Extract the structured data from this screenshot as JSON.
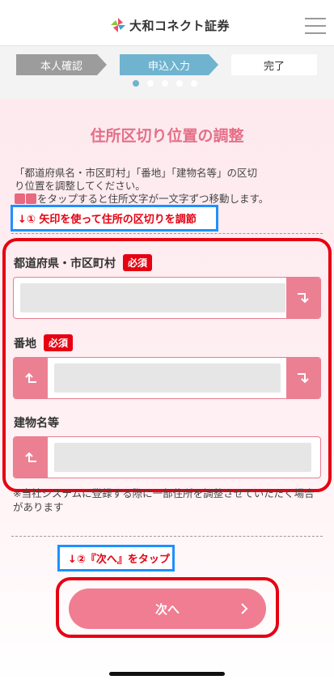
{
  "header": {
    "logo_text": "大和コネクト証券",
    "logo_icon": "daiwa-mark-icon",
    "menu_icon": "hamburger-menu-icon"
  },
  "stepper": {
    "steps": [
      "本人確認",
      "申込入力",
      "完了"
    ],
    "active_step": 2,
    "dots_total": 5,
    "dots_active": 1
  },
  "page": {
    "title": "住所区切り位置の調整",
    "description_line1": "「都道府県名・市区町村」「番地」「建物名等」の区切",
    "description_line2": "り位置を調整してください。",
    "description_line3": "をタップすると住所文字が一文字ずつ移動します。"
  },
  "annotations": {
    "step1": "↓① 矢印を使って住所の区切りを調節",
    "step2": "↓②『次へ』をタップ"
  },
  "fields": [
    {
      "label": "都道府県・市区町村",
      "required_label": "必須",
      "value": ""
    },
    {
      "label": "番地",
      "required_label": "必須",
      "value": ""
    },
    {
      "label": "建物名等",
      "required_label": "",
      "value": ""
    }
  ],
  "note": "※当社システムに登録する際に一部住所を調整させていただく場合があります",
  "next_button": {
    "label": "次へ",
    "icon": "chevron-right-icon"
  },
  "colors": {
    "accent": "#ec8093",
    "title": "#e56f87",
    "required": "#e60012",
    "step_active": "#6fb3cf",
    "step_done": "#9c9c9c"
  }
}
